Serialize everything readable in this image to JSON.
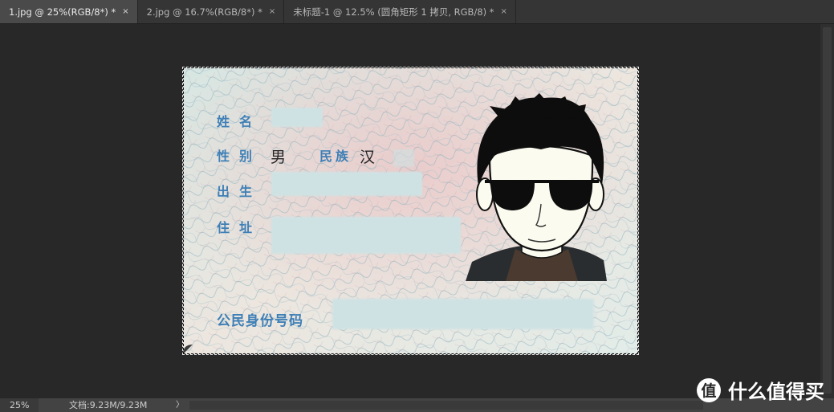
{
  "tabs": [
    {
      "label": "1.jpg @ 25%(RGB/8*) *",
      "close": "×",
      "active": true
    },
    {
      "label": "2.jpg @ 16.7%(RGB/8*) *",
      "close": "×",
      "active": false
    },
    {
      "label": "未标题-1 @ 12.5% (圆角矩形 1 拷贝, RGB/8) *",
      "close": "×",
      "active": false
    }
  ],
  "card": {
    "name_label": "姓名",
    "sex_label": "性别",
    "sex_value": "男",
    "ethnicity_label": "民族",
    "ethnicity_value": "汉",
    "birth_label": "出生",
    "address_label": "住址",
    "id_number_label": "公民身份号码"
  },
  "status": {
    "zoom": "25%",
    "doc_info": "文档:9.23M/9.23M",
    "arrow": "〉"
  },
  "watermark": {
    "badge": "值",
    "text": "什么值得买"
  },
  "colors": {
    "label_blue": "#3e7fb6",
    "app_bg": "#282828",
    "redaction": "#cfe2e3"
  }
}
